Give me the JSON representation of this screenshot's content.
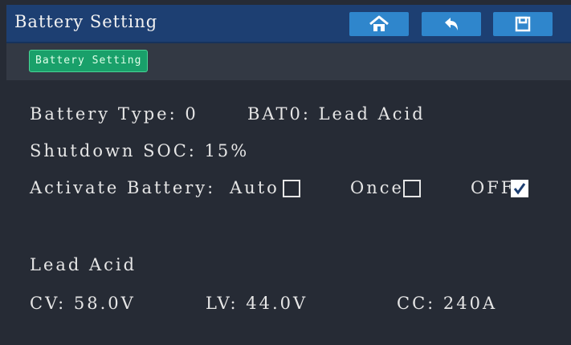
{
  "header": {
    "title": "Battery Setting",
    "home_icon": "home-icon",
    "back_icon": "back-arrow-icon",
    "save_icon": "save-icon"
  },
  "tab": {
    "label": "Battery Setting"
  },
  "settings": {
    "battery_type": "Battery Type: 0",
    "bat_profile": "BAT0: Lead Acid",
    "shutdown_soc": "Shutdown SOC: 15%",
    "activate_label": "Activate Battery:",
    "activate_options": [
      {
        "label": "Auto",
        "checked": false
      },
      {
        "label": "Once",
        "checked": false
      },
      {
        "label": "OFF",
        "checked": true
      }
    ]
  },
  "profile": {
    "name": "Lead Acid",
    "cv": "CV: 58.0V",
    "lv": "LV: 44.0V",
    "cc": "CC: 240A"
  },
  "colors": {
    "background": "#262b35",
    "titlebar": "#1d3f72",
    "button": "#2f86cc",
    "tab_active": "#19a06a"
  }
}
